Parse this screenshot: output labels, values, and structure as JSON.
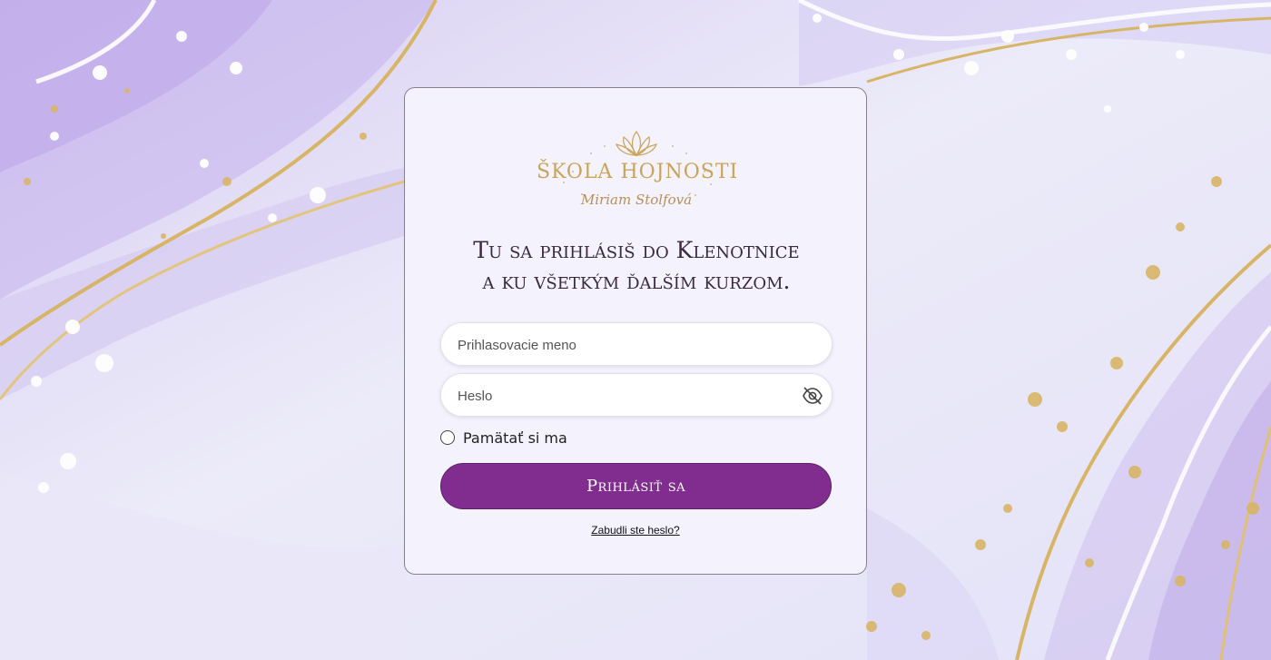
{
  "brand": {
    "name": "ŠKOLA HOJNOSTI",
    "signature": "Miriam Stolfová"
  },
  "login": {
    "heading_line1": "Tu sa prihlásiš do Klenotnice",
    "heading_line2": "a ku všetkým ďalším kurzom.",
    "username_placeholder": "Prihlasovacie meno",
    "username_value": "",
    "password_placeholder": "Heslo",
    "password_value": "",
    "password_toggle_icon": "eye-slash-icon",
    "remember_label": "Pamätať si ma",
    "remember_checked": false,
    "submit_label": "Prihlásiť sa",
    "forgot_label": "Zabudli ste heslo?"
  },
  "colors": {
    "accent": "#812d8f",
    "gold": "#c9a45a",
    "card_background": "#f3f2fd"
  }
}
